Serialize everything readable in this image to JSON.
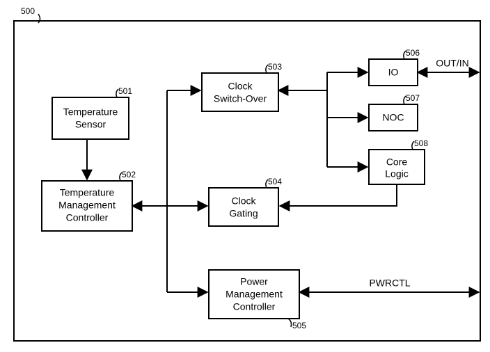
{
  "figure_ref": "500",
  "blocks": {
    "temp_sensor": {
      "ref": "501",
      "line1": "Temperature",
      "line2": "Sensor"
    },
    "temp_mgmt": {
      "ref": "502",
      "line1": "Temperature",
      "line2": "Management",
      "line3": "Controller"
    },
    "clock_switch": {
      "ref": "503",
      "line1": "Clock",
      "line2": "Switch-Over"
    },
    "clock_gating": {
      "ref": "504",
      "line1": "Clock",
      "line2": "Gating"
    },
    "power_mgmt": {
      "ref": "505",
      "line1": "Power",
      "line2": "Management",
      "line3": "Controller"
    },
    "io": {
      "ref": "506",
      "line1": "IO"
    },
    "noc": {
      "ref": "507",
      "line1": "NOC"
    },
    "core_logic": {
      "ref": "508",
      "line1": "Core",
      "line2": "Logic"
    }
  },
  "signals": {
    "out_in": "OUT/IN",
    "pwrctl": "PWRCTL"
  },
  "chart_data": {
    "type": "block_diagram",
    "container_ref": "500",
    "nodes": [
      {
        "id": "temp_sensor",
        "ref": "501",
        "label": "Temperature Sensor"
      },
      {
        "id": "temp_mgmt",
        "ref": "502",
        "label": "Temperature Management Controller"
      },
      {
        "id": "clock_switch",
        "ref": "503",
        "label": "Clock Switch-Over"
      },
      {
        "id": "clock_gating",
        "ref": "504",
        "label": "Clock Gating"
      },
      {
        "id": "power_mgmt",
        "ref": "505",
        "label": "Power Management Controller"
      },
      {
        "id": "io",
        "ref": "506",
        "label": "IO"
      },
      {
        "id": "noc",
        "ref": "507",
        "label": "NOC"
      },
      {
        "id": "core_logic",
        "ref": "508",
        "label": "Core Logic"
      }
    ],
    "edges": [
      {
        "from": "temp_sensor",
        "to": "temp_mgmt",
        "bidir": false
      },
      {
        "from": "temp_mgmt",
        "to": "clock_switch",
        "bidir": true
      },
      {
        "from": "temp_mgmt",
        "to": "clock_gating",
        "bidir": true
      },
      {
        "from": "temp_mgmt",
        "to": "power_mgmt",
        "bidir": true
      },
      {
        "from": "clock_switch",
        "to": "io",
        "bidir": true
      },
      {
        "from": "clock_switch",
        "to": "noc",
        "bidir": false,
        "note": "branch toward NOC"
      },
      {
        "from": "clock_switch",
        "to": "core_logic",
        "bidir": false,
        "note": "branch toward Core Logic"
      },
      {
        "from": "core_logic",
        "to": "clock_gating",
        "bidir": false
      }
    ],
    "external_edges": [
      {
        "node": "io",
        "label": "OUT/IN",
        "bidir": true
      },
      {
        "node": "power_mgmt",
        "label": "PWRCTL",
        "bidir": true
      }
    ]
  }
}
